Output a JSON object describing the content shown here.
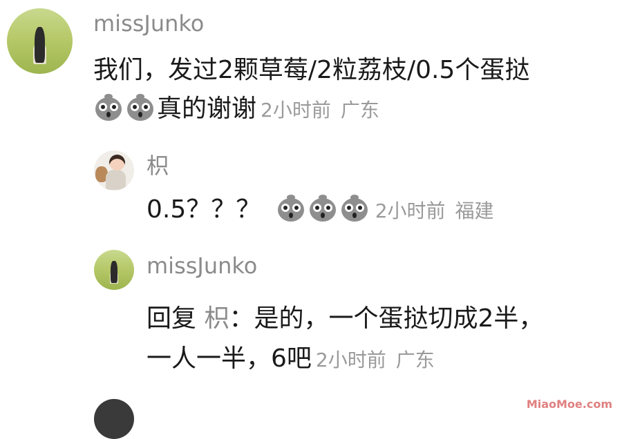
{
  "comments": [
    {
      "username": "missJunko",
      "line1": "我们，发过2颗草莓/2粒荔枝/0.5个蛋挞",
      "line2": "真的谢谢",
      "emoji_count": 2,
      "emoji_icon": "round-grey-face-emoji",
      "time": "2小时前",
      "location": "广东"
    }
  ],
  "replies": [
    {
      "username": "枳",
      "text": "0.5？？？",
      "emoji_count": 3,
      "time": "2小时前",
      "location": "福建"
    },
    {
      "username": "missJunko",
      "reply_label": "回复",
      "reply_to": "枳",
      "line1": "：是的，一个蛋挞切成2半，",
      "line2": "一人一半，6吧",
      "time": "2小时前",
      "location": "广东"
    }
  ],
  "watermark": "MiaoMoe.com"
}
